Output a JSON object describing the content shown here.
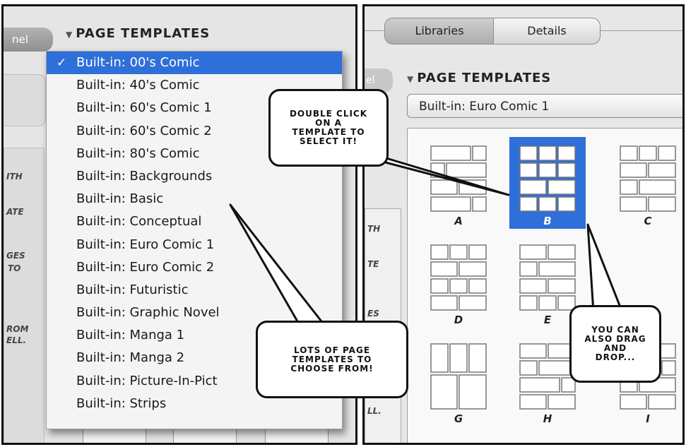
{
  "left_panel": {
    "tab_label": "nel",
    "header": "PAGE TEMPLATES",
    "clipped_words": [
      "ITH",
      "ATE",
      "GES",
      "TO",
      "ROM",
      "ELL."
    ],
    "menu": {
      "selected_index": 0,
      "items": [
        "Built-in: 00's Comic",
        "Built-in: 40's Comic",
        "Built-in: 60's Comic 1",
        "Built-in: 60's Comic 2",
        "Built-in: 80's Comic",
        "Built-in: Backgrounds",
        "Built-in: Basic",
        "Built-in: Conceptual",
        "Built-in: Euro Comic 1",
        "Built-in: Euro Comic 2",
        "Built-in: Futuristic",
        "Built-in: Graphic Novel",
        "Built-in: Manga 1",
        "Built-in: Manga 2",
        "Built-in: Picture-In-Pict",
        "Built-in: Strips"
      ]
    }
  },
  "right_panel": {
    "tabs": [
      "Libraries",
      "Details"
    ],
    "active_tab": "Libraries",
    "header": "PAGE TEMPLATES",
    "selected_template_set": "Built-in: Euro Comic 1",
    "clipped_words": [
      "TH",
      "TE",
      "ES",
      "LL."
    ],
    "templates": [
      {
        "label": "A",
        "selected": false
      },
      {
        "label": "B",
        "selected": true
      },
      {
        "label": "C",
        "selected": false
      },
      {
        "label": "D",
        "selected": false
      },
      {
        "label": "E",
        "selected": false
      },
      {
        "label": "G",
        "selected": false
      },
      {
        "label": "H",
        "selected": false
      },
      {
        "label": "I",
        "selected": false
      }
    ]
  },
  "callouts": {
    "double_click": "DOUBLE CLICK ON A TEMPLATE TO SELECT IT!",
    "lots_templates": "LOTS OF PAGE TEMPLATES TO CHOOSE FROM!",
    "drag_drop": "YOU CAN ALSO DRAG AND DROP..."
  },
  "colors": {
    "selection_blue": "#2e6fd9",
    "panel_border": "#111111"
  }
}
